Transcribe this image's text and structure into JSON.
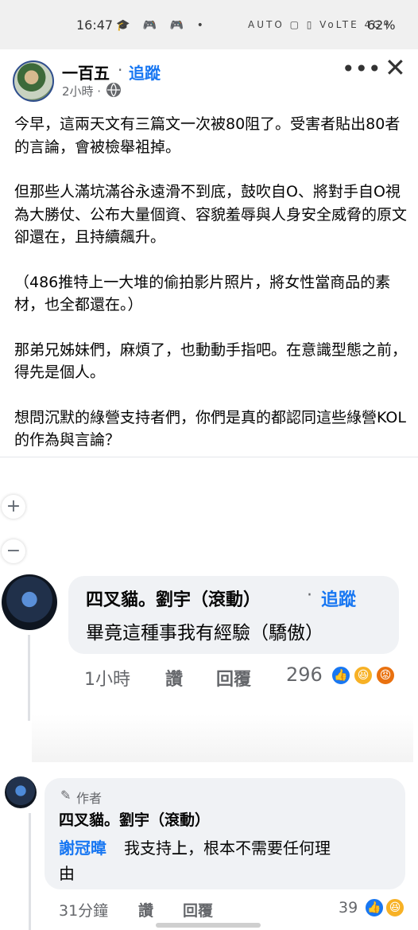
{
  "status_bar": {
    "time": "16:47",
    "left_icons": "🎓 🎮 🎮 •",
    "right_icons": "AUTO ▢ ▯ VoLTE 4G+",
    "battery": "62%"
  },
  "post": {
    "author": "一百五",
    "follow_label": "追蹤",
    "dot": "·",
    "time": "2小時 ·",
    "paragraphs": [
      "今早，這兩天文有三篇文一次被80阻了。受害者貼出80者的言論，會被檢舉袓掉。",
      "但那些人滿坑滿谷永遠滑不到底，鼓吹自O、將對手自O視為大勝仗、公布大量個資、容貌羞辱與人身安全威脅的原文卻還在，且持續飆升。",
      "（486推特上一大堆的偷拍影片照片，將女性當商品的素材，也全都還在。）",
      "那弟兄姊妹們，麻煩了，也動動手指吧。在意識型態之前，得先是個人。",
      "想問沉默的綠營支持者們，你們是真的都認同這些綠營KOL的作為與言論？"
    ]
  },
  "side_controls": {
    "plus": "+",
    "minus": "−"
  },
  "comments": [
    {
      "name": "四叉貓。劉宇（滾動）",
      "follow_dot": "·",
      "follow_label": "追蹤",
      "text": "畢竟這種事我有經驗（驕傲）",
      "time": "1小時",
      "like": "讚",
      "reply": "回覆",
      "reaction_count": "296"
    },
    {
      "badge": "作者",
      "name": "四叉貓。劉宇（滾動）",
      "tag": "謝冠暐",
      "text_line1": "我支持㆖，根本不需要任何理",
      "text_line2": "由",
      "time": "31分鐘",
      "like": "讚",
      "reply": "回覆",
      "reaction_count": "39"
    }
  ],
  "icons": {
    "more": "more-icon",
    "close": "close-icon",
    "globe": "globe-icon",
    "pencil": "pencil-icon",
    "like_reaction": "like-reaction-icon",
    "haha_reaction": "haha-reaction-icon",
    "angry_reaction": "angry-reaction-icon"
  },
  "colors": {
    "accent": "#1877f2",
    "bubble": "#f0f2f5",
    "meta": "#65676b"
  }
}
